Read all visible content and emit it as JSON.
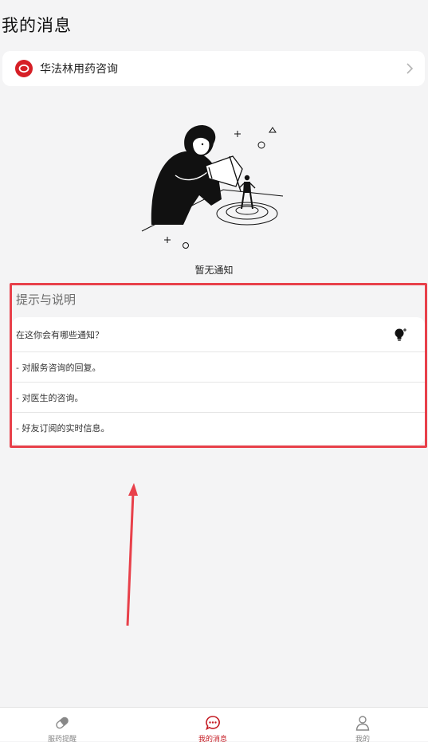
{
  "header": {
    "title": "我的消息"
  },
  "consult": {
    "label": "华法林用药咨询"
  },
  "empty": {
    "text": "暂无通知"
  },
  "tips": {
    "title": "提示与说明",
    "rows": [
      {
        "text": "在这你会有哪些通知？"
      },
      {
        "text": "- 对服务咨询的回复。"
      },
      {
        "text": "- 对医生的咨询。"
      },
      {
        "text": "- 好友订阅的实时信息。"
      }
    ]
  },
  "tabs": [
    {
      "label": "服药提醒",
      "icon": "pill-icon",
      "active": false
    },
    {
      "label": "我的消息",
      "icon": "chat-bubble-icon",
      "active": true
    },
    {
      "label": "我的",
      "icon": "user-icon",
      "active": false
    }
  ],
  "colors": {
    "accent": "#c41b23",
    "highlight": "#e8404a",
    "background": "#f4f4f5"
  }
}
